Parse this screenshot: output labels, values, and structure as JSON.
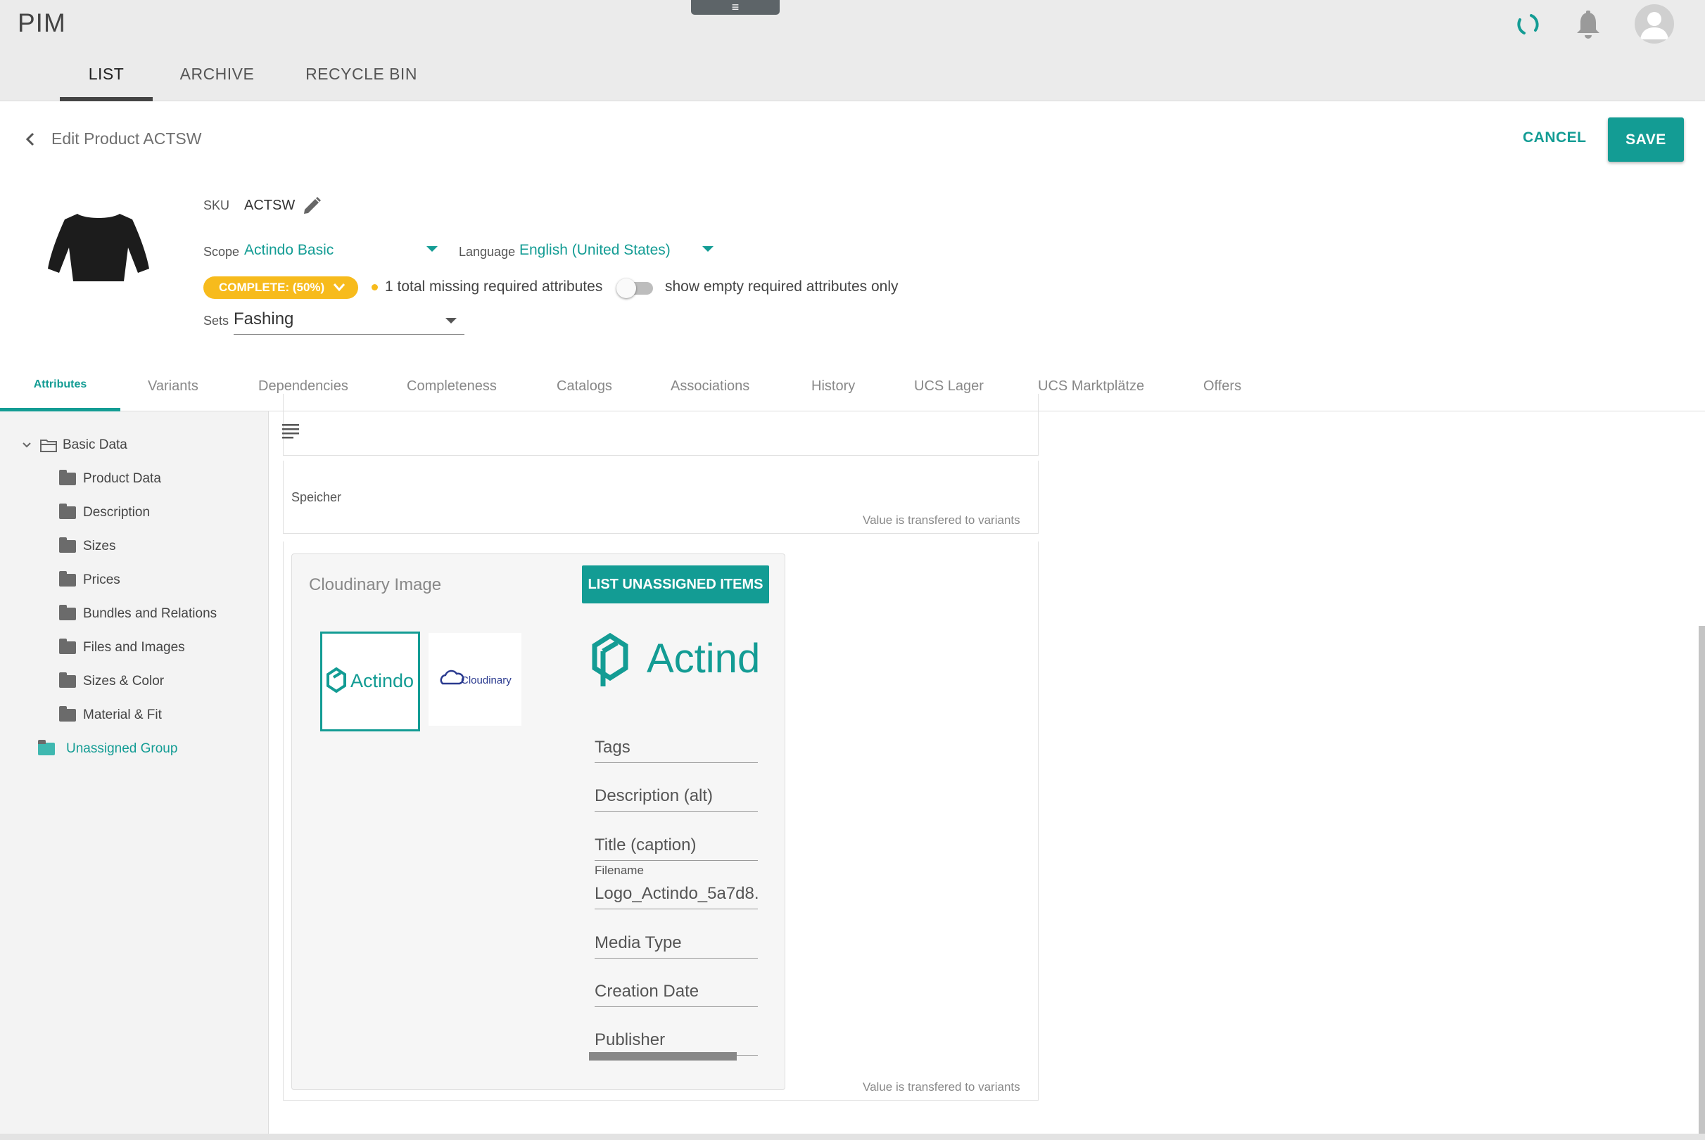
{
  "app": {
    "title": "PIM",
    "menu_handle": "≡"
  },
  "top_tabs": [
    {
      "label": "LIST",
      "active": true
    },
    {
      "label": "ARCHIVE",
      "active": false
    },
    {
      "label": "RECYCLE BIN",
      "active": false
    }
  ],
  "header": {
    "title": "Edit Product ACTSW",
    "cancel_label": "CANCEL",
    "save_label": "SAVE"
  },
  "product": {
    "sku_label": "SKU",
    "sku": "ACTSW",
    "scope_label": "Scope",
    "scope": "Actindo Basic",
    "language_label": "Language",
    "language": "English (United States)",
    "complete_badge": "COMPLETE: (50%)",
    "missing_text": "1 total missing required attributes",
    "toggle_label": "show empty required attributes only",
    "sets_label": "Sets",
    "sets_value": "Fashing"
  },
  "section_tabs": [
    "Attributes",
    "Variants",
    "Dependencies",
    "Completeness",
    "Catalogs",
    "Associations",
    "History",
    "UCS Lager",
    "UCS Marktplätze",
    "Offers"
  ],
  "tree": {
    "root": "Basic Data",
    "children": [
      "Product Data",
      "Description",
      "Sizes",
      "Prices",
      "Bundles and Relations",
      "Files and Images",
      "Sizes & Color",
      "Material & Fit"
    ],
    "unassigned": "Unassigned Group"
  },
  "fields": {
    "speicher_label": "Speicher",
    "transfer_note": "Value is transfered to variants"
  },
  "cloudinary": {
    "title": "Cloudinary Image",
    "list_button": "LIST UNASSIGNED ITEMS",
    "thumb1_text": "Actindo",
    "thumb2_text": "Cloudinary",
    "preview_text": "Actind",
    "tags": "Tags",
    "description_alt": "Description (alt)",
    "title_caption": "Title (caption)",
    "filename_label": "Filename",
    "filename_value": "Logo_Actindo_5a7d8.",
    "media_type": "Media Type",
    "creation_date": "Creation Date",
    "publisher": "Publisher"
  },
  "colors": {
    "accent": "#139c94",
    "badge": "#f7bb1c",
    "topbar": "#ebebeb"
  },
  "icons": [
    "sync-icon",
    "bell-icon",
    "avatar-icon",
    "back-icon",
    "edit-icon",
    "chevron-down-icon",
    "folder-icon",
    "folder-open-icon",
    "menu-lines-icon"
  ]
}
